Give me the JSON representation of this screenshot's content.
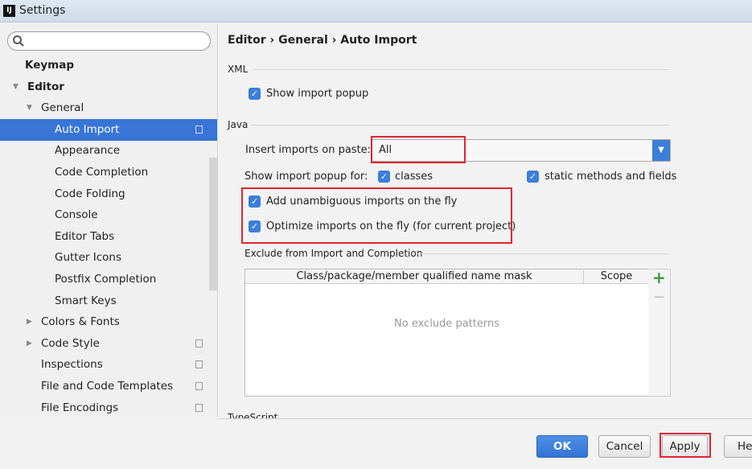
{
  "window": {
    "title": "Settings",
    "icon": "intellij-icon"
  },
  "sidebar": {
    "search_placeholder": "",
    "items": [
      {
        "label": "Keymap",
        "level": 0,
        "bold": true
      },
      {
        "label": "Editor",
        "level": 0,
        "bold": true,
        "expanded": true
      },
      {
        "label": "General",
        "level": 1,
        "expanded": true
      },
      {
        "label": "Auto Import",
        "level": 2,
        "selected": true,
        "copy_icon": true
      },
      {
        "label": "Appearance",
        "level": 2
      },
      {
        "label": "Code Completion",
        "level": 2
      },
      {
        "label": "Code Folding",
        "level": 2
      },
      {
        "label": "Console",
        "level": 2
      },
      {
        "label": "Editor Tabs",
        "level": 2
      },
      {
        "label": "Gutter Icons",
        "level": 2
      },
      {
        "label": "Postfix Completion",
        "level": 2
      },
      {
        "label": "Smart Keys",
        "level": 2
      },
      {
        "label": "Colors & Fonts",
        "level": 1,
        "collapsed": true
      },
      {
        "label": "Code Style",
        "level": 1,
        "collapsed": true,
        "copy_icon": true
      },
      {
        "label": "Inspections",
        "level": 1,
        "copy_icon": true
      },
      {
        "label": "File and Code Templates",
        "level": 1,
        "copy_icon": true
      },
      {
        "label": "File Encodings",
        "level": 1,
        "copy_icon": true
      }
    ]
  },
  "breadcrumb": {
    "p1": "Editor",
    "p2": "General",
    "p3": "Auto Import",
    "sep": "›"
  },
  "xml": {
    "section": "XML",
    "show_popup": "Show import popup",
    "show_popup_checked": true
  },
  "java": {
    "section": "Java",
    "insert_label": "Insert imports on paste:",
    "insert_value": "All",
    "popup_for_label": "Show import popup for:",
    "classes": "classes",
    "classes_checked": true,
    "static": "static methods and fields",
    "static_checked": true,
    "add_unambiguous": "Add unambiguous imports on the fly",
    "add_checked": true,
    "optimize": "Optimize imports on the fly (for current project)",
    "optimize_checked": true
  },
  "exclude": {
    "section": "Exclude from Import and Completion",
    "columns": [
      "Class/package/member qualified name mask",
      "Scope"
    ],
    "empty": "No exclude patterns",
    "add": "+",
    "remove": "−"
  },
  "next_section": "TypeScript",
  "buttons": {
    "ok": "OK",
    "cancel": "Cancel",
    "apply": "Apply",
    "help": "Help"
  },
  "colors": {
    "accent": "#3875d7",
    "highlight": "#e0242f"
  }
}
